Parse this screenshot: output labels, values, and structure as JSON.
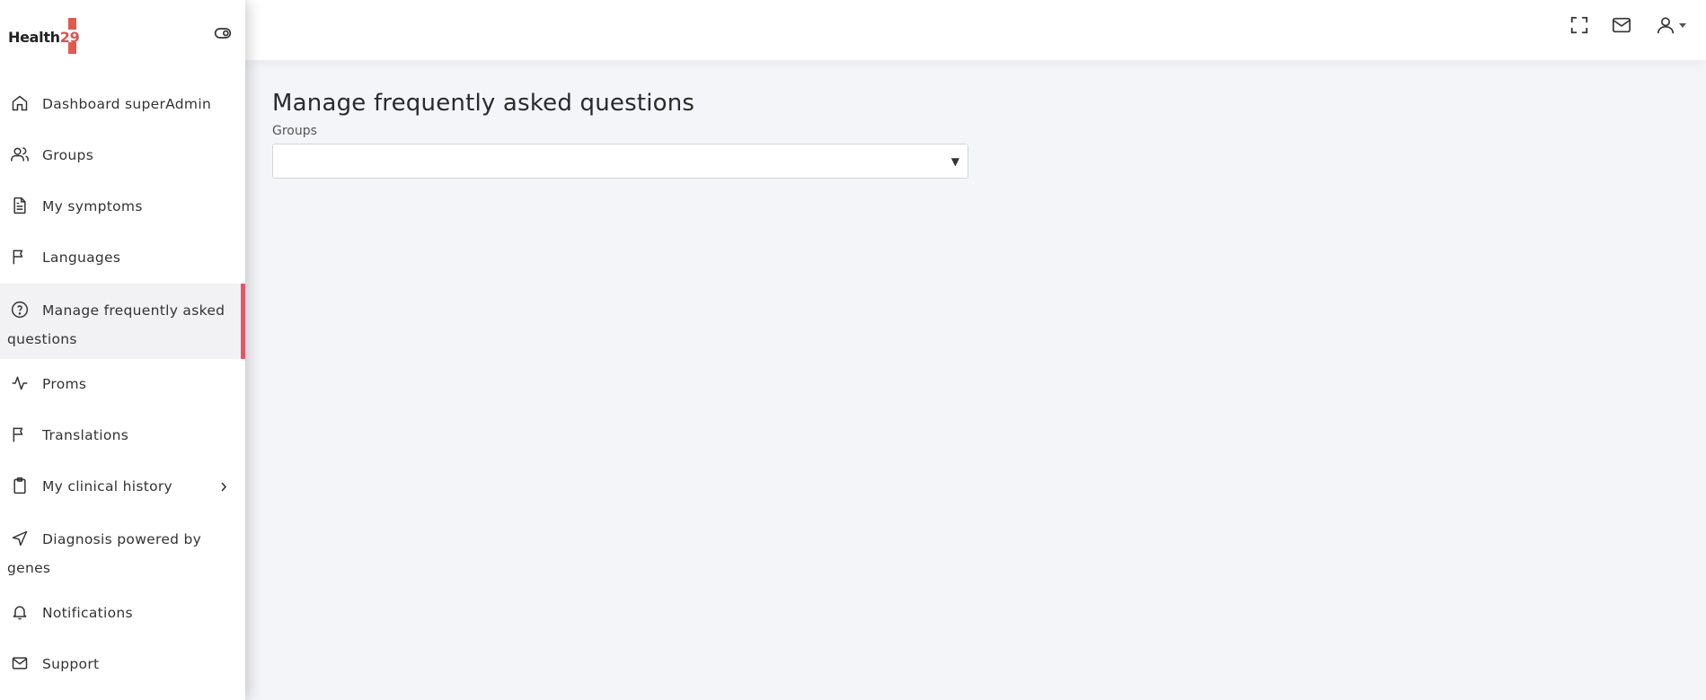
{
  "brand": {
    "name": "Health",
    "number": "29"
  },
  "sidebar": {
    "items": [
      {
        "label": "Dashboard superAdmin",
        "icon": "home-icon"
      },
      {
        "label": "Groups",
        "icon": "users-icon"
      },
      {
        "label": "My symptoms",
        "icon": "document-icon"
      },
      {
        "label": "Languages",
        "icon": "flag-icon"
      },
      {
        "label": "Manage frequently asked questions",
        "icon": "help-circle-icon",
        "active": true
      },
      {
        "label": "Proms",
        "icon": "activity-icon"
      },
      {
        "label": "Translations",
        "icon": "flag-icon"
      },
      {
        "label": "My clinical history",
        "icon": "clipboard-icon",
        "has_submenu": true
      },
      {
        "label": "Diagnosis powered by genes",
        "icon": "navigation-icon"
      },
      {
        "label": "Notifications",
        "icon": "bell-icon"
      },
      {
        "label": "Support",
        "icon": "mail-icon"
      }
    ]
  },
  "topbar": {
    "icons": [
      "fullscreen-icon",
      "mail-icon",
      "user-icon",
      "caret-down-icon"
    ]
  },
  "main": {
    "title": "Manage frequently asked questions",
    "groups_label": "Groups",
    "groups_select_value": ""
  },
  "colors": {
    "accent": "#e5546a",
    "brand_red": "#d9534f",
    "background": "#f4f5f9"
  }
}
